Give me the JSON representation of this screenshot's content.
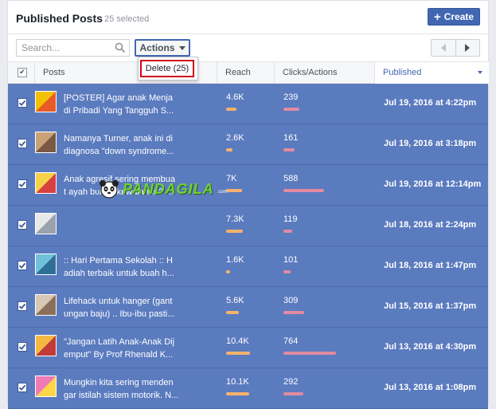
{
  "header": {
    "title": "Published Posts",
    "selected": "25 selected",
    "create_label": "Create"
  },
  "toolbar": {
    "search_placeholder": "Search...",
    "actions_label": "Actions"
  },
  "dropdown": {
    "delete_label": "Delete (25)"
  },
  "table": {
    "columns": [
      "Posts",
      "Reach",
      "Clicks/Actions",
      "Published"
    ],
    "rows": [
      {
        "post": "[POSTER] Agar anak Menja\ndi Pribadi Yang Tangguh S...",
        "reach": "4.6K",
        "reach_frac": 0.44,
        "clicks": "239",
        "clicks_frac": 0.31,
        "date": "Jul 19, 2016 at 4:22pm",
        "thumb": [
          "#f2c200",
          "#e85a2a"
        ]
      },
      {
        "post": "Namanya Turner, anak ini di\ndiagnosa \"down syndrome...",
        "reach": "2.6K",
        "reach_frac": 0.25,
        "clicks": "161",
        "clicks_frac": 0.21,
        "date": "Jul 19, 2016 at 3:18pm",
        "thumb": [
          "#c9a27a",
          "#7a5a45"
        ]
      },
      {
        "post": "Anak agresif sering membua\nt ayah bunda kewalahan? ...",
        "reach": "7K",
        "reach_frac": 0.67,
        "clicks": "588",
        "clicks_frac": 0.77,
        "date": "Jul 19, 2016 at 12:14pm",
        "thumb": [
          "#f6d24a",
          "#d94141"
        ]
      },
      {
        "post": "",
        "reach": "7.3K",
        "reach_frac": 0.7,
        "clicks": "119",
        "clicks_frac": 0.16,
        "date": "Jul 18, 2016 at 2:24pm",
        "thumb": [
          "#e8e8e8",
          "#9aa2ad"
        ]
      },
      {
        "post": ":: Hari Pertama Sekolah :: H\nadiah terbaik untuk buah h...",
        "reach": "1.6K",
        "reach_frac": 0.15,
        "clicks": "101",
        "clicks_frac": 0.13,
        "date": "Jul 18, 2016 at 1:47pm",
        "thumb": [
          "#6fc0d8",
          "#2f6f95"
        ]
      },
      {
        "post": "Lifehack untuk hanger (gant\nungan baju) .. Ibu-ibu pasti...",
        "reach": "5.6K",
        "reach_frac": 0.54,
        "clicks": "309",
        "clicks_frac": 0.4,
        "date": "Jul 15, 2016 at 1:37pm",
        "thumb": [
          "#d7c7b4",
          "#8c6f5a"
        ]
      },
      {
        "post": "\"Jangan Latih Anak-Anak Dij\nemput\" By Prof Rhenald K...",
        "reach": "10.4K",
        "reach_frac": 1.0,
        "clicks": "764",
        "clicks_frac": 1.0,
        "date": "Jul 13, 2016 at 4:30pm",
        "thumb": [
          "#f5b942",
          "#c23b3b"
        ]
      },
      {
        "post": "Mungkin kita sering menden\ngar istilah sistem motorik. N...",
        "reach": "10.1K",
        "reach_frac": 0.97,
        "clicks": "292",
        "clicks_frac": 0.38,
        "date": "Jul 13, 2016 at 1:08pm",
        "thumb": [
          "#f07ab5",
          "#ffd54a"
        ]
      }
    ]
  },
  "watermark": {
    "text": "PANDAGILA",
    "suffix": ".com"
  },
  "colors": {
    "accent": "#4267b2",
    "selected_row": "#5b7bbf",
    "reach_bar": "#f7b26b",
    "clicks_bar": "#e28ba2",
    "highlight": "#d0021b"
  }
}
